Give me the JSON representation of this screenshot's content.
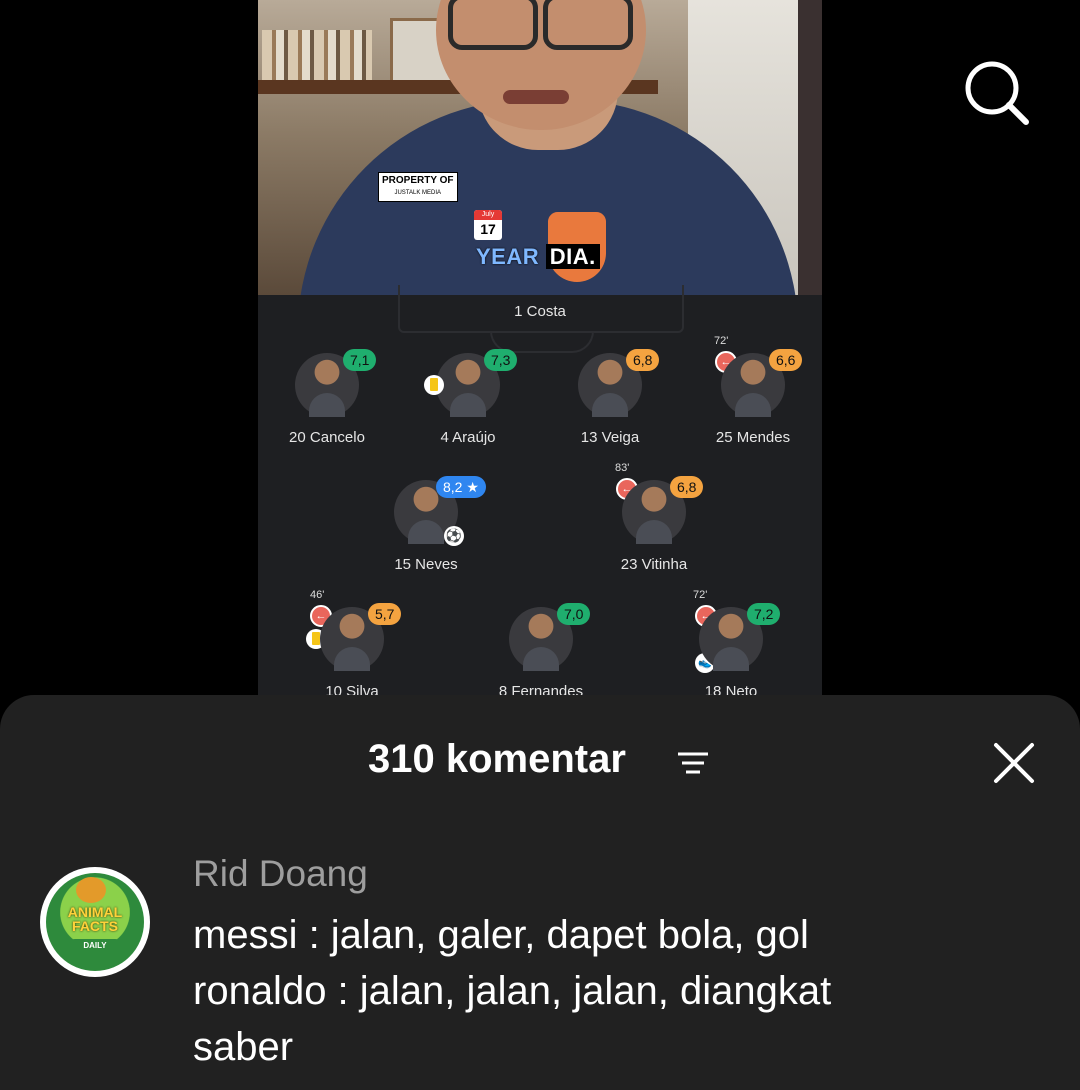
{
  "video": {
    "watermark_line1": "PROPERTY OF",
    "watermark_line2": "JUSTALK MEDIA",
    "calendar_month": "July",
    "calendar_day": "17",
    "caption_highlight": "YEAR",
    "caption_rest": "DIA."
  },
  "lineup": {
    "goalkeeper": "1 Costa",
    "players": [
      {
        "name": "20 Cancelo",
        "rating": "7,1",
        "rating_color": "#1fae6e"
      },
      {
        "name": "4 Araújo",
        "rating": "7,3",
        "rating_color": "#1fae6e"
      },
      {
        "name": "13 Veiga",
        "rating": "6,8",
        "rating_color": "#f4a340"
      },
      {
        "name": "25 Mendes",
        "rating": "6,6",
        "rating_color": "#f4a340",
        "sub_time": "72'"
      },
      {
        "name": "15 Neves",
        "rating": "8,2 ★",
        "rating_color": "#2f86f0"
      },
      {
        "name": "23 Vitinha",
        "rating": "6,8",
        "rating_color": "#f4a340",
        "sub_time": "83'"
      },
      {
        "name": "10 Silva",
        "rating": "5,7",
        "rating_color": "#f4a340",
        "sub_time": "46'"
      },
      {
        "name": "8 Fernandes",
        "rating": "7,0",
        "rating_color": "#1fae6e"
      },
      {
        "name": "18 Neto",
        "rating": "7,2",
        "rating_color": "#1fae6e",
        "sub_time": "72'"
      }
    ]
  },
  "icons": {
    "search": "search-icon",
    "sort": "sort-icon",
    "close": "close-icon",
    "substitution": "substitution-arrow-icon",
    "yellow_card": "yellow-card-icon",
    "goal": "football-icon",
    "assist": "boot-icon"
  },
  "comments": {
    "header": "310 komentar",
    "items": [
      {
        "avatar_text": "ANIMAL FACTS",
        "avatar_subtext": "DAILY",
        "username": "Rid Doang",
        "text": "messi : jalan, galer, dapet bola, gol\nronaldo : jalan, jalan, jalan, diangkat\nsaber"
      }
    ]
  },
  "colors": {
    "sheet_bg": "#212121",
    "username": "#9e9e9e",
    "rating_green": "#1fae6e",
    "rating_orange": "#f4a340",
    "rating_blue": "#2f86f0"
  }
}
